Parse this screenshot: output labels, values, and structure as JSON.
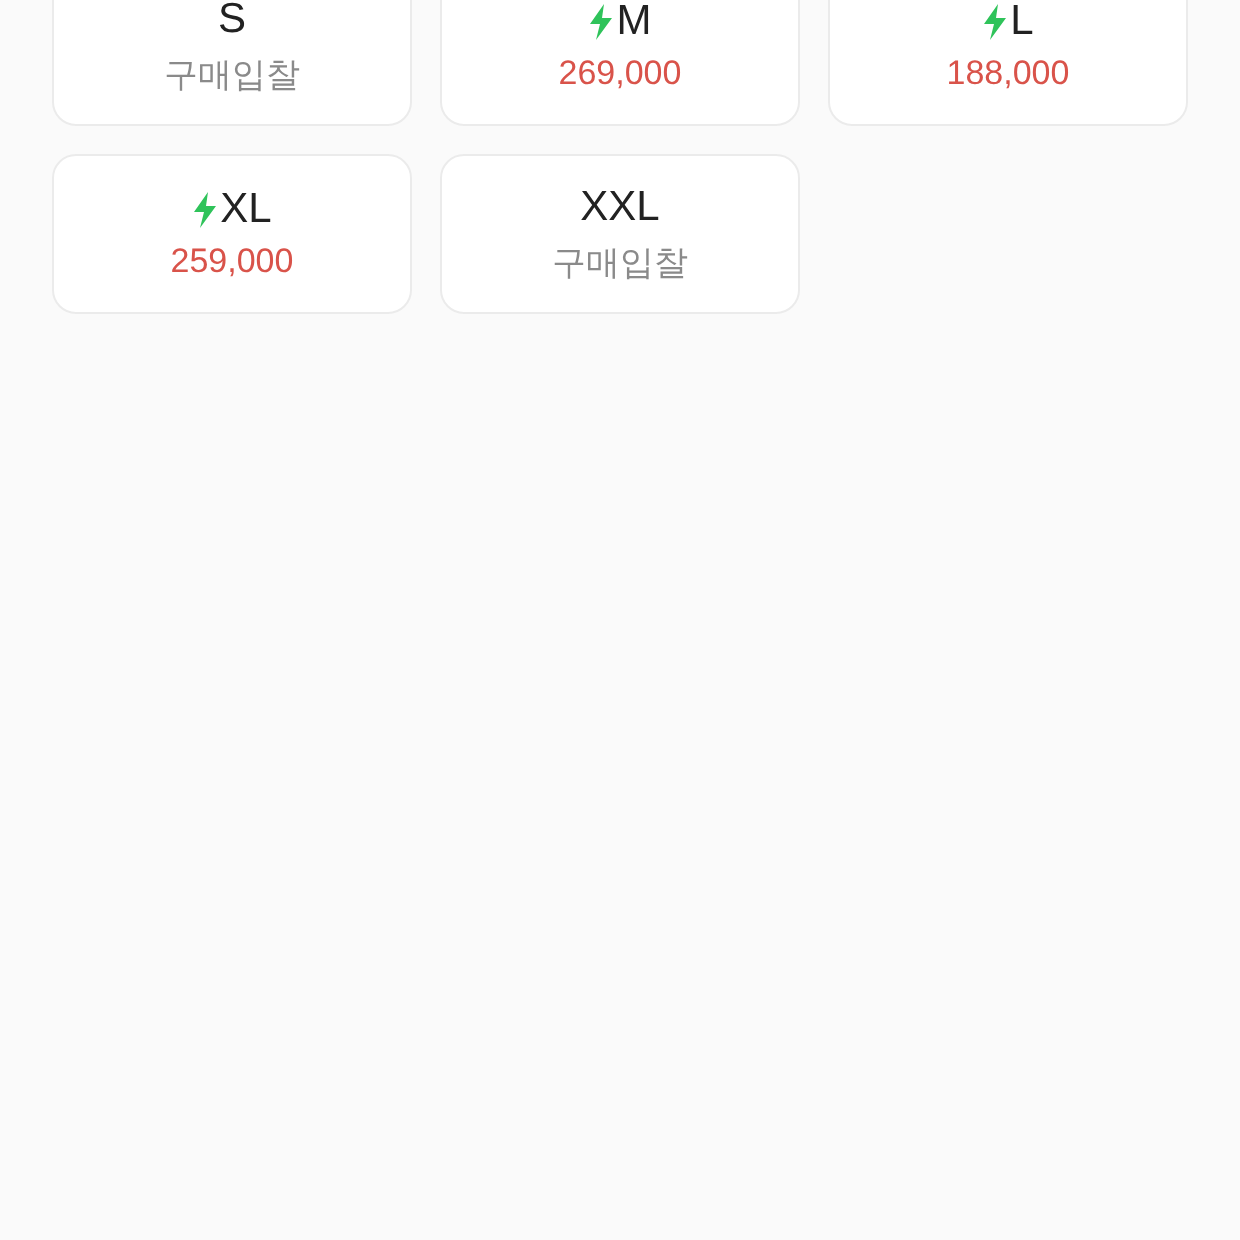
{
  "sizes": [
    {
      "size": "S",
      "express": false,
      "kind": "bid",
      "value": "구매입찰"
    },
    {
      "size": "M",
      "express": true,
      "kind": "price",
      "value": "269,000"
    },
    {
      "size": "L",
      "express": true,
      "kind": "price",
      "value": "188,000"
    },
    {
      "size": "XL",
      "express": true,
      "kind": "price",
      "value": "259,000"
    },
    {
      "size": "XXL",
      "express": false,
      "kind": "bid",
      "value": "구매입찰"
    }
  ]
}
